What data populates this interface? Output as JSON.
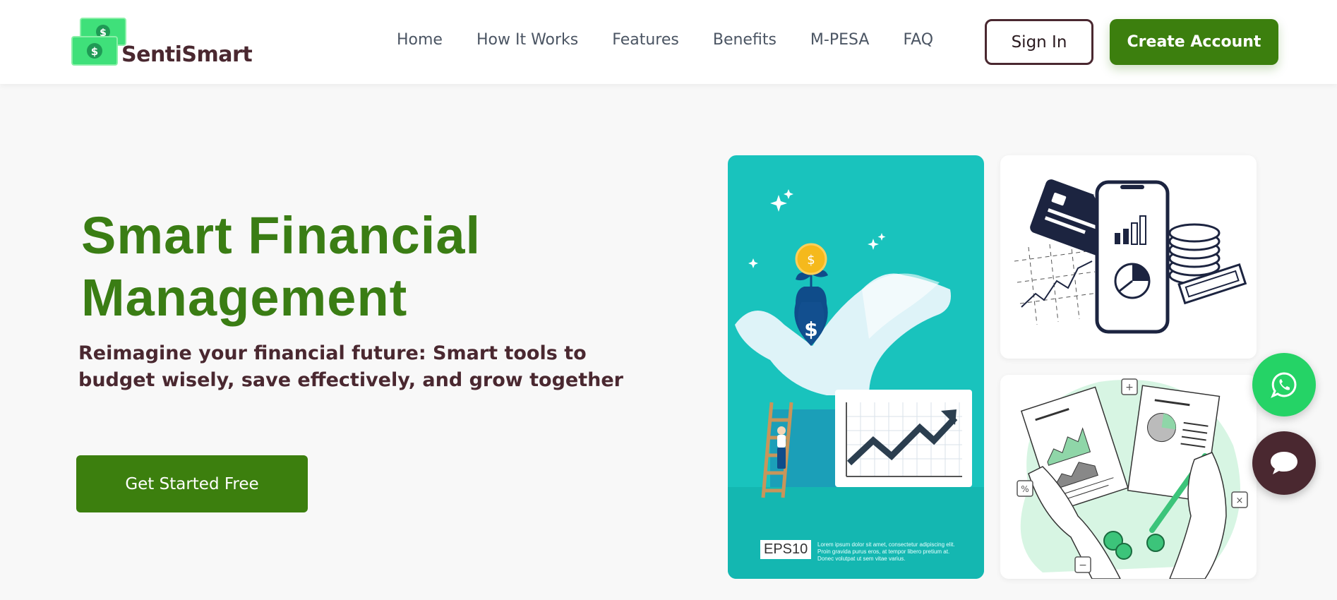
{
  "brand": {
    "name": "SentiSmart",
    "logo_icon": "dollar-bills-icon"
  },
  "nav": {
    "items": [
      {
        "label": "Home"
      },
      {
        "label": "How It Works"
      },
      {
        "label": "Features"
      },
      {
        "label": "Benefits"
      },
      {
        "label": "M-PESA"
      },
      {
        "label": "FAQ"
      }
    ]
  },
  "header_actions": {
    "sign_in": "Sign In",
    "create_account": "Create Account"
  },
  "hero": {
    "title_line1": "Smart Financial",
    "title_line2": "Management",
    "subtitle": "Reimagine your financial future: Smart tools to budget wisely, save effectively, and grow together",
    "cta": "Get Started Free"
  },
  "illustrations": {
    "teal_card": {
      "eps_label": "EPS10",
      "fine_print": "Lorem ipsum dolor sit amet, consectetur adipiscing elit. Proin gravida purus eros, at tempor libero pretium at. Donec volutpat ut sem vitae varius."
    },
    "phone_card_icon": "phone-finance-icon",
    "docs_card_icon": "financial-reports-icon"
  },
  "floating": {
    "whatsapp_icon": "whatsapp-icon",
    "chat_icon": "chat-bubble-icon"
  },
  "colors": {
    "brand_green": "#3c7f0e",
    "brand_maroon": "#4a2830",
    "teal": "#19c3bd",
    "whatsapp_green": "#25d366"
  }
}
